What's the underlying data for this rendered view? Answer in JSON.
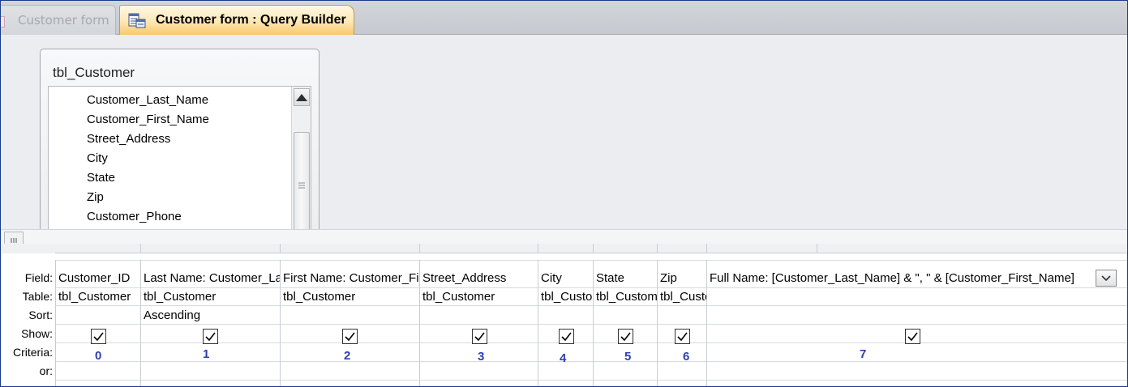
{
  "tabs": [
    {
      "label": "Customer form",
      "active": false
    },
    {
      "label": "Customer form : Query Builder",
      "active": true
    }
  ],
  "table": {
    "name": "tbl_Customer",
    "fields": [
      "Customer_Last_Name",
      "Customer_First_Name",
      "Street_Address",
      "City",
      "State",
      "Zip",
      "Customer_Phone"
    ]
  },
  "grid": {
    "row_labels": [
      "Field:",
      "Table:",
      "Sort:",
      "Show:",
      "Criteria:",
      "or:"
    ],
    "columns": [
      {
        "field": "Customer_ID",
        "table": "tbl_Customer",
        "sort": "",
        "show": true,
        "index": "0"
      },
      {
        "field": "Last Name: Customer_Last_Name",
        "table": "tbl_Customer",
        "sort": "Ascending",
        "show": true,
        "index": "1"
      },
      {
        "field": "First Name: Customer_First_Name",
        "table": "tbl_Customer",
        "sort": "",
        "show": true,
        "index": "2"
      },
      {
        "field": "Street_Address",
        "table": "tbl_Customer",
        "sort": "",
        "show": true,
        "index": "3"
      },
      {
        "field": "City",
        "table": "tbl_Customer",
        "sort": "",
        "show": true,
        "index": "4"
      },
      {
        "field": "State",
        "table": "tbl_Customer",
        "sort": "",
        "show": true,
        "index": "5"
      },
      {
        "field": "Zip",
        "table": "tbl_Customer",
        "sort": "",
        "show": true,
        "index": "6"
      },
      {
        "field": "Full Name: [Customer_Last_Name] & \", \" & [Customer_First_Name]",
        "table": "",
        "sort": "",
        "show": true,
        "index": "7"
      }
    ]
  },
  "colors": {
    "active_tab": "#fde7b4",
    "index_numbers": "#2d3fb0",
    "splitter": "#6f7d96"
  },
  "icons": {
    "query_builder": "query-builder-icon",
    "dropdown": "chevron-down-icon",
    "checkbox": "checkmark-icon"
  }
}
